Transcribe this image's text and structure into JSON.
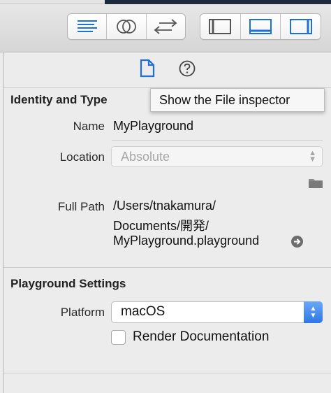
{
  "toolbar": {
    "editor_buttons": [
      {
        "name": "standard-editor-icon",
        "active": true
      },
      {
        "name": "assistant-editor-icon",
        "active": false
      },
      {
        "name": "version-editor-icon",
        "active": false
      }
    ],
    "view_buttons": [
      {
        "name": "navigator-toggle-icon",
        "active": false
      },
      {
        "name": "debug-area-toggle-icon",
        "active": true
      },
      {
        "name": "utilities-toggle-icon",
        "active": true
      }
    ]
  },
  "inspector_tabs": {
    "file_tab_icon": "document-icon",
    "help_tab_icon": "question-circle-icon",
    "tooltip": "Show the File inspector"
  },
  "identity": {
    "title": "Identity and Type",
    "name_label": "Name",
    "name_value": "MyPlayground",
    "location_label": "Location",
    "location_value": "Absolute",
    "full_path_label": "Full Path",
    "full_path_lines": [
      "/Users/tnakamura/",
      "Documents/開発/",
      "MyPlayground.playground"
    ]
  },
  "playground_settings": {
    "title": "Playground Settings",
    "platform_label": "Platform",
    "platform_value": "macOS",
    "render_docs_label": "Render Documentation",
    "render_docs_checked": false
  },
  "colors": {
    "accent": "#2f77e6",
    "icon_blue": "#1f6fd8",
    "disabled_text": "#a7a7a7"
  }
}
